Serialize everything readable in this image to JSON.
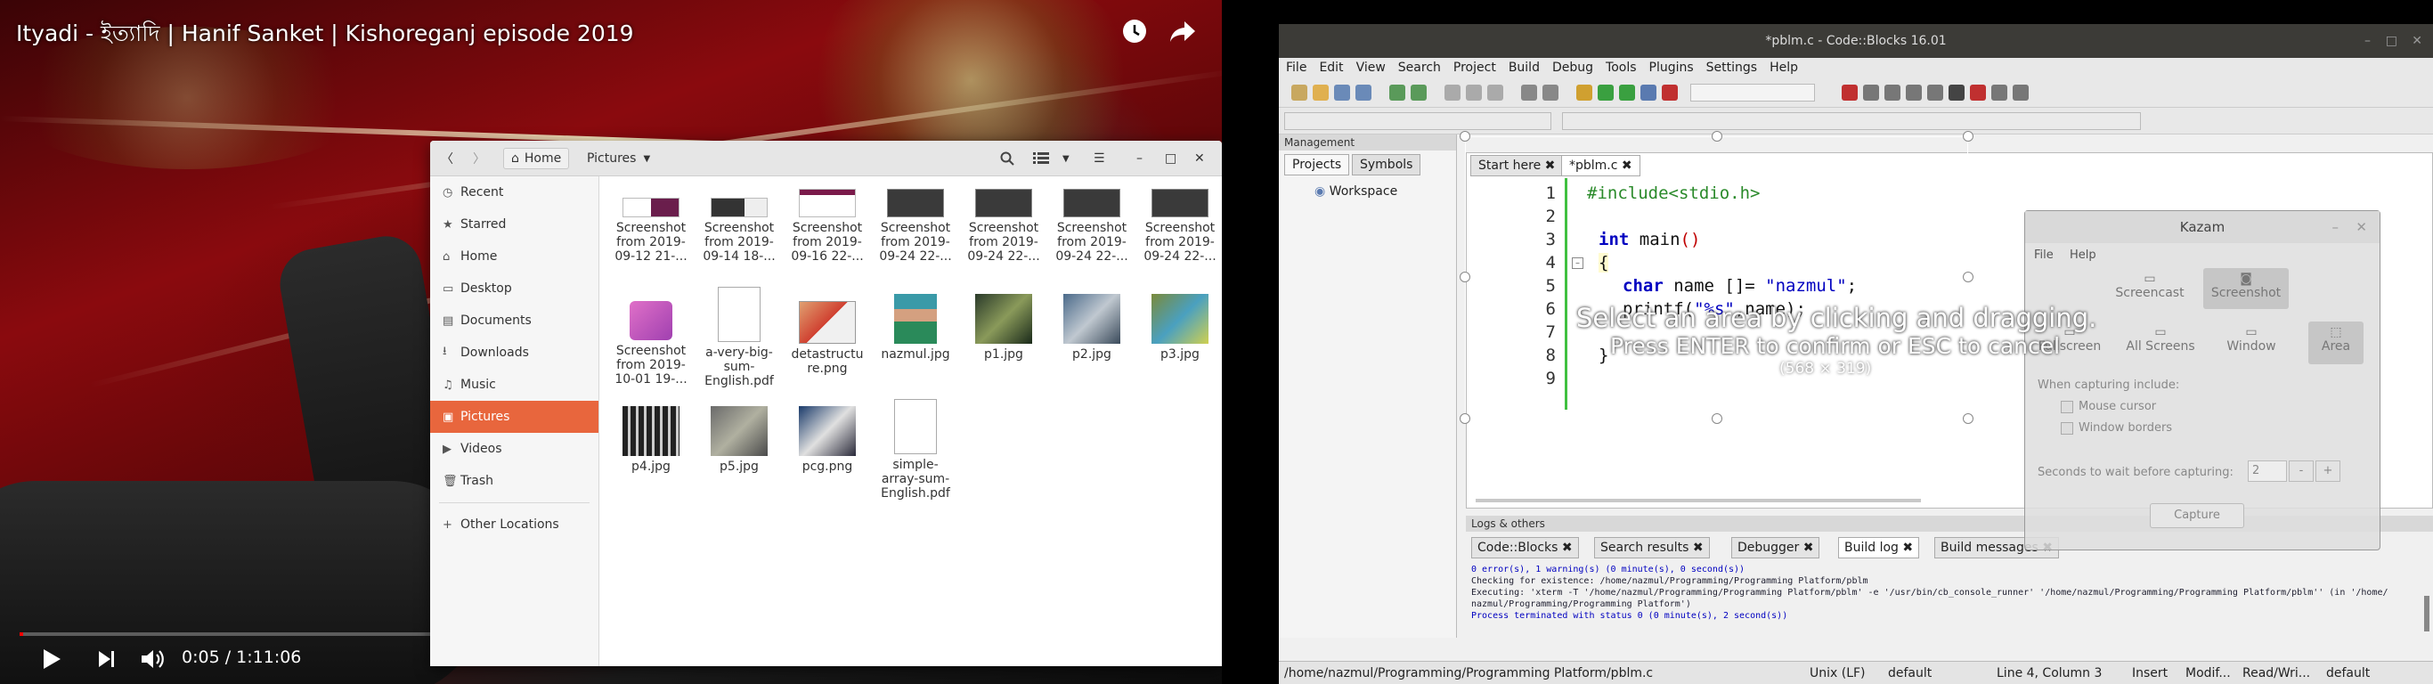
{
  "video": {
    "title": "Ityadi - ইত্যাদি | Hanif Sanket | Kishoreganj episode 2019",
    "time": "0:05 / 1:11:06",
    "progress": 0.0012,
    "icons": {
      "watch_later": "clock-icon",
      "share": "share-icon",
      "play": "play-icon",
      "next": "next-icon",
      "volume": "volume-icon"
    }
  },
  "files": {
    "nav": {
      "home": "Home",
      "pictures": "Pictures"
    },
    "sidebar": [
      {
        "icon": "clock-icon",
        "label": "Recent"
      },
      {
        "icon": "star-icon",
        "label": "Starred"
      },
      {
        "icon": "home-icon",
        "label": "Home"
      },
      {
        "icon": "desktop-icon",
        "label": "Desktop"
      },
      {
        "icon": "document-icon",
        "label": "Documents"
      },
      {
        "icon": "download-icon",
        "label": "Downloads"
      },
      {
        "icon": "music-icon",
        "label": "Music"
      },
      {
        "icon": "picture-icon",
        "label": "Pictures"
      },
      {
        "icon": "video-icon",
        "label": "Videos"
      },
      {
        "icon": "trash-icon",
        "label": "Trash"
      }
    ],
    "other_locations": "Other Locations",
    "items": [
      {
        "line1": "Screenshot",
        "line2": "from 2019-",
        "line3": "09-12 21-..."
      },
      {
        "line1": "Screenshot",
        "line2": "from 2019-",
        "line3": "09-14 18-..."
      },
      {
        "line1": "Screenshot",
        "line2": "from 2019-",
        "line3": "09-16 22-..."
      },
      {
        "line1": "Screenshot",
        "line2": "from 2019-",
        "line3": "09-24 22-..."
      },
      {
        "line1": "Screenshot",
        "line2": "from 2019-",
        "line3": "09-24 22-..."
      },
      {
        "line1": "Screenshot",
        "line2": "from 2019-",
        "line3": "09-24 22-..."
      },
      {
        "line1": "Screenshot",
        "line2": "from 2019-",
        "line3": "09-24 22-..."
      },
      {
        "line1": "Screenshot",
        "line2": "from 2019-",
        "line3": "10-01 19-..."
      },
      {
        "line1": "a-very-big-",
        "line2": "sum-",
        "line3": "English.pdf"
      },
      {
        "line1": "detastructu",
        "line2": "re.png",
        "line3": ""
      },
      {
        "line1": "nazmul.jpg",
        "line2": "",
        "line3": ""
      },
      {
        "line1": "p1.jpg",
        "line2": "",
        "line3": ""
      },
      {
        "line1": "p2.jpg",
        "line2": "",
        "line3": ""
      },
      {
        "line1": "p3.jpg",
        "line2": "",
        "line3": ""
      },
      {
        "line1": "p4.jpg",
        "line2": "",
        "line3": ""
      },
      {
        "line1": "p5.jpg",
        "line2": "",
        "line3": ""
      },
      {
        "line1": "pcg.png",
        "line2": "",
        "line3": ""
      },
      {
        "line1": "simple-",
        "line2": "array-sum-",
        "line3": "English.pdf"
      }
    ]
  },
  "codeblocks": {
    "title": "*pblm.c - Code::Blocks 16.01",
    "menu": [
      "File",
      "Edit",
      "View",
      "Search",
      "Project",
      "Build",
      "Debug",
      "Tools",
      "Plugins",
      "Settings",
      "Help"
    ],
    "management": {
      "title": "Management",
      "tabs": [
        "Projects",
        "Symbols"
      ],
      "workspace": "Workspace"
    },
    "editor_tabs": [
      "Start here",
      "*pblm.c"
    ],
    "line_numbers": [
      "1",
      "2",
      "3",
      "4",
      "5",
      "6",
      "7",
      "8",
      "9"
    ],
    "code": {
      "l1": "#include<stdio.h>",
      "l3_type": "int",
      "l3_name": " main",
      "l3_paren": "()",
      "l4": "{",
      "l5_type": "char",
      "l5_rest": " name []= ",
      "l5_str": "\"nazmul\"",
      "l5_end": ";",
      "l6_a": "printf(",
      "l6_str": "\"%s\"",
      "l6_b": ",name);",
      "l8": "}"
    },
    "logs": {
      "title": "Logs & others",
      "tabs": [
        "Code::Blocks",
        "Search results",
        "Debugger",
        "Build log",
        "Build messages"
      ],
      "lines": [
        "0 error(s), 1 warning(s) (0 minute(s), 0 second(s))",
        "",
        "Checking for existence: /home/nazmul/Programming/Programming Platform/pblm",
        "Executing: 'xterm -T '/home/nazmul/Programming/Programming Platform/pblm' -e '/usr/bin/cb_console_runner' '/home/nazmul/Programming/Programming Platform/pblm'' (in '/home/",
        "nazmul/Programming/Programming Platform')",
        "Process terminated with status 0 (0 minute(s), 2 second(s))"
      ]
    },
    "status": {
      "path": "/home/nazmul/Programming/Programming Platform/pblm.c",
      "eol": "Unix (LF)",
      "encoding": "default",
      "position": "Line 4, Column 3",
      "mode": "Insert",
      "modified": "Modif...",
      "rw": "Read/Wri...",
      "lang": "default"
    }
  },
  "kazam": {
    "title": "Kazam",
    "menu": [
      "File",
      "Help"
    ],
    "modes": [
      "Screencast",
      "Screenshot"
    ],
    "areas": [
      "Fullscreen",
      "All Screens",
      "Window",
      "Area"
    ],
    "capture_label": "When capturing include:",
    "opt_mouse": "Mouse cursor",
    "opt_borders": "Window borders",
    "wait_label": "Seconds to wait before capturing:",
    "wait_value": "2",
    "minus": "-",
    "plus": "+",
    "capture_button": "Capture"
  },
  "selection": {
    "msg1": "Select an area by clicking and dragging.",
    "msg2": "Press ENTER to confirm or ESC to cancel",
    "dims": "(568 × 319)"
  },
  "colors": {
    "accent": "#e8663d",
    "progress": "#ff0000",
    "cb_title": "#3c3b37"
  }
}
